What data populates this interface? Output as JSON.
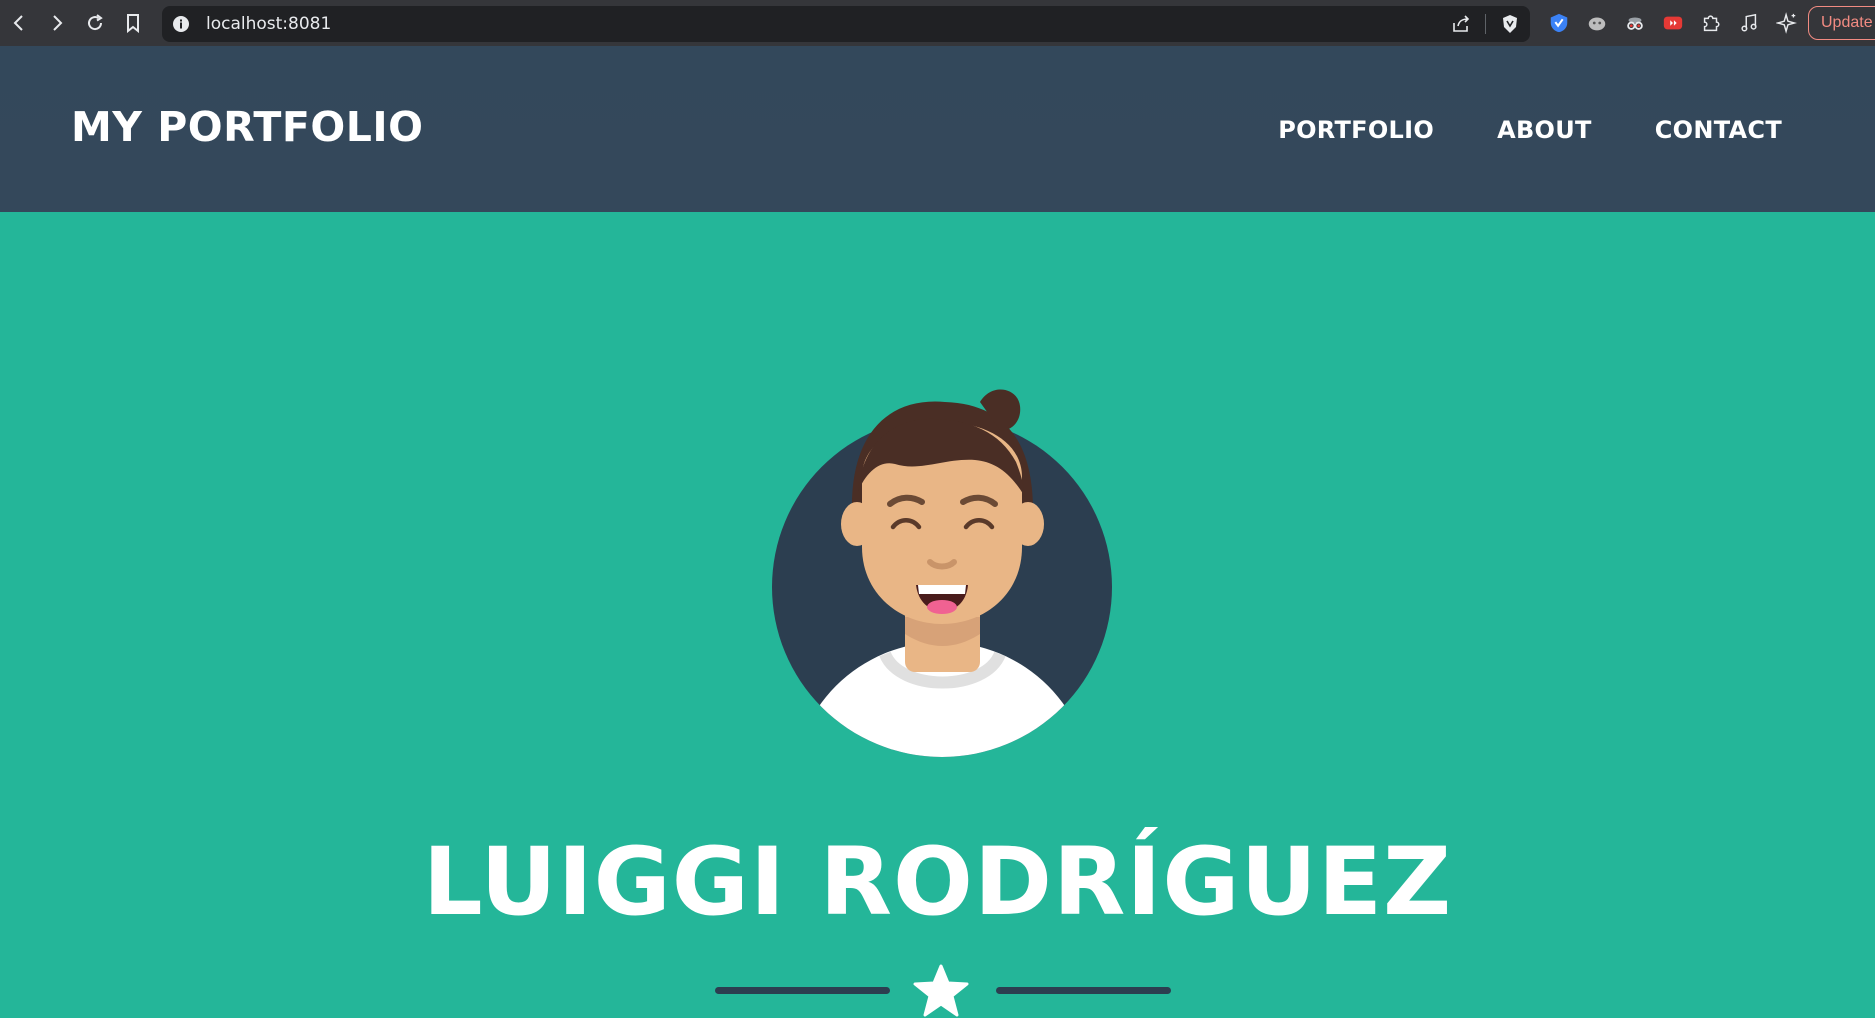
{
  "browser": {
    "url": "localhost:8081",
    "update_label": "Update",
    "nav_icons": [
      "back-icon",
      "forward-icon",
      "reload-icon",
      "bookmark-icon"
    ],
    "extension_icons": [
      "vpn-icon",
      "ghost-icon",
      "spy-icon",
      "youtube-icon",
      "puzzle-icon",
      "music-icon",
      "sparkle-icon"
    ]
  },
  "site": {
    "brand": "MY PORTFOLIO",
    "menu": [
      {
        "label": "PORTFOLIO"
      },
      {
        "label": "ABOUT"
      },
      {
        "label": "CONTACT"
      }
    ]
  },
  "hero": {
    "name": "LUIGGI RODRÍGUEZ"
  },
  "colors": {
    "nav_bg": "#34485b",
    "hero_bg": "#24b699",
    "avatar_bg": "#2c3e50",
    "text": "#ffffff"
  }
}
